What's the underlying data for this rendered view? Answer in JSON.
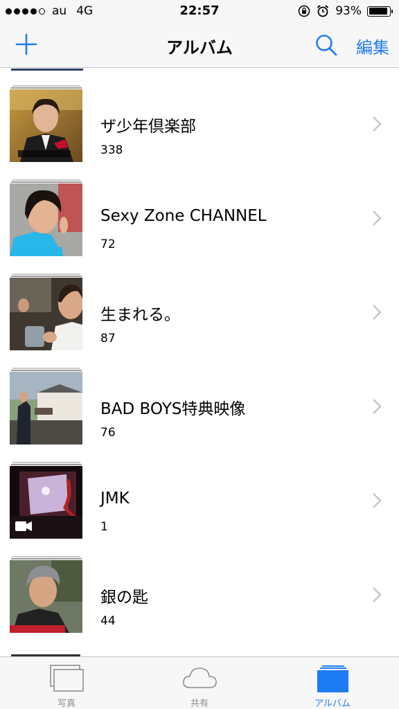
{
  "status_bar": {
    "carrier": "au",
    "network": "4G",
    "time": "22:57",
    "battery_percent": "93%",
    "battery_level": 0.93,
    "icons": [
      "signal-dots",
      "rotation-lock-icon",
      "alarm-icon",
      "battery-icon"
    ]
  },
  "nav": {
    "title": "アルバム",
    "add_icon": "plus-icon",
    "search_icon": "search-icon",
    "edit_label": "編集"
  },
  "albums": [
    {
      "name": "ザ少年倶楽部",
      "count": "338"
    },
    {
      "name": "Sexy Zone CHANNEL",
      "count": "72"
    },
    {
      "name": "生まれる。",
      "count": "87"
    },
    {
      "name": "BAD BOYS特典映像",
      "count": "76"
    },
    {
      "name": "JMK",
      "count": "1"
    },
    {
      "name": "銀の匙",
      "count": "44"
    }
  ],
  "tabs": [
    {
      "label": "写真",
      "icon": "photos-icon",
      "active": false
    },
    {
      "label": "共有",
      "icon": "cloud-icon",
      "active": false
    },
    {
      "label": "アルバム",
      "icon": "albums-icon",
      "active": true
    }
  ],
  "colors": {
    "accent": "#1e7cf5",
    "inactive": "#8e8e93",
    "bar_background": "#f7f7f7",
    "separator": "#c8c7cc"
  }
}
